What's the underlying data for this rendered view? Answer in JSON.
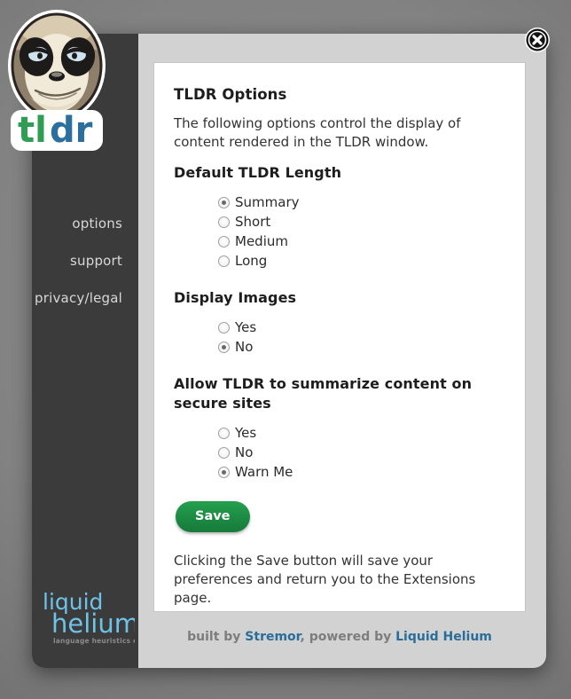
{
  "window": {
    "close_label": "close",
    "close_icon": "close-circle-icon"
  },
  "sidebar": {
    "logo": {
      "icon": "tldr-sloth-logo",
      "wordmark_part1": "tl",
      "wordmark_part2": "dr"
    },
    "items": [
      {
        "label": "options"
      },
      {
        "label": "support"
      },
      {
        "label": "privacy/legal"
      }
    ],
    "brand": {
      "icon": "liquid-helium-logo",
      "line1": "liquid",
      "line2": "helium",
      "tagline": "language heuristics engine"
    }
  },
  "main": {
    "title": "TLDR Options",
    "intro": "The following options control the display of content rendered in the TLDR window.",
    "groups": [
      {
        "id": "default-tldr-length",
        "title": "Default TLDR Length",
        "options": [
          {
            "label": "Summary",
            "checked": true
          },
          {
            "label": "Short",
            "checked": false
          },
          {
            "label": "Medium",
            "checked": false
          },
          {
            "label": "Long",
            "checked": false
          }
        ]
      },
      {
        "id": "display-images",
        "title": "Display Images",
        "options": [
          {
            "label": "Yes",
            "checked": false
          },
          {
            "label": "No",
            "checked": true
          }
        ]
      },
      {
        "id": "secure-sites",
        "title": "Allow TLDR to summarize content on secure sites",
        "options": [
          {
            "label": "Yes",
            "checked": false
          },
          {
            "label": "No",
            "checked": false
          },
          {
            "label": "Warn Me",
            "checked": true
          }
        ]
      }
    ],
    "save_label": "Save",
    "note": "Clicking the Save button will save your preferences and return you to the Extensions page."
  },
  "footer": {
    "prefix": "built by ",
    "link1": "Stremor",
    "middle": ", powered by ",
    "link2": "Liquid Helium"
  },
  "colors": {
    "backdrop": "#7f7f7f",
    "modal": "#d2d2d2",
    "sidebar": "#3b3b3b",
    "content": "#ffffff",
    "save_green": "#1c8a43",
    "link_blue": "#2a6d99",
    "brand_blue": "#6fc2e8",
    "tldr_green": "#2f9e52",
    "tldr_blue": "#2a6f9e"
  }
}
